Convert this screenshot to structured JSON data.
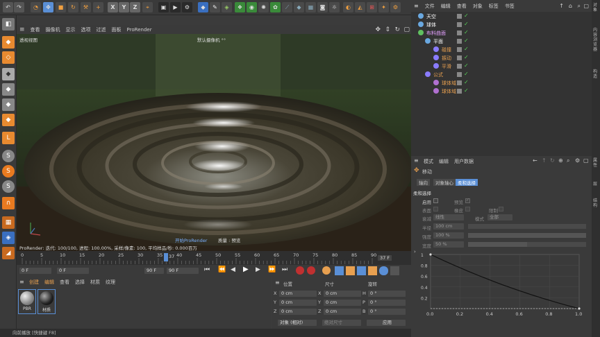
{
  "toolbar": {
    "icons": [
      "undo-icon",
      "redo-icon",
      "live-select-icon",
      "move-icon",
      "scale-icon",
      "rotate-icon",
      "recent-tools-icon",
      "add-icon",
      "x-axis-icon",
      "y-axis-icon",
      "z-axis-icon",
      "coordinate-system-icon",
      "render-region-icon",
      "render-view-icon",
      "render-settings-icon",
      "cube-icon",
      "pen-icon",
      "subdivision-icon",
      "cloner-icon",
      "deformer-icon",
      "environment-icon",
      "camera-icon",
      "light-icon",
      "hair-icon",
      "axis-snap-icon",
      "workplane-icon",
      "script-icon"
    ],
    "axes": [
      "X",
      "Y",
      "Z"
    ]
  },
  "viewport": {
    "menu": [
      "查看",
      "摄像机",
      "显示",
      "选项",
      "过滤",
      "面板",
      "ProRender"
    ],
    "label_left": "透视视图",
    "label_center": "默认摄像机 °°",
    "prorender_button": "开始ProRender",
    "quality": "质量 : 预览",
    "status": "ProRender: 迭代: 100/100, 进程: 100.00%, 采样/像素: 100, 平均样品/秒: 0.000百万"
  },
  "timeline": {
    "ticks": [
      "0",
      "5",
      "10",
      "15",
      "20",
      "25",
      "30",
      "35",
      "40",
      "45",
      "50",
      "55",
      "60",
      "65",
      "70",
      "75",
      "80",
      "85",
      "90"
    ],
    "current_frame": "37",
    "frame_badge": "37 F",
    "start": "0 F",
    "pos": "0 F",
    "end": "90 F",
    "end2": "90 F"
  },
  "material": {
    "menu": [
      "创建",
      "编辑",
      "查看",
      "选择",
      "材质",
      "纹理"
    ],
    "items": [
      {
        "name": "PBR"
      },
      {
        "name": "材质"
      }
    ]
  },
  "coords": {
    "headers": [
      "位置",
      "尺寸",
      "旋转"
    ],
    "rows": [
      {
        "axis": "X",
        "pos": "0 cm",
        "size_axis": "X",
        "size": "0 cm",
        "rot_axis": "H",
        "rot": "0 °"
      },
      {
        "axis": "Y",
        "pos": "0 cm",
        "size_axis": "Y",
        "size": "0 cm",
        "rot_axis": "P",
        "rot": "0 °"
      },
      {
        "axis": "Z",
        "pos": "0 cm",
        "size_axis": "Z",
        "size": "0 cm",
        "rot_axis": "B",
        "rot": "0 °"
      }
    ],
    "mode": "对象 (相对)",
    "size_mode": "绝对尺寸",
    "apply": "应用"
  },
  "status_bar": "向前播放 [快捷键 F8]",
  "object_manager": {
    "menu": [
      "文件",
      "编辑",
      "查看",
      "对象",
      "标签",
      "书签"
    ],
    "objects": [
      {
        "name": "天空",
        "indent": 0,
        "color": "#ffffff",
        "icon": "sky-icon",
        "icon_color": "#6aa8e0"
      },
      {
        "name": "球体",
        "indent": 0,
        "color": "#ffffff",
        "icon": "sphere-icon",
        "icon_color": "#6aa8e0"
      },
      {
        "name": "布料曲面",
        "indent": 0,
        "color": "#e4a0ff",
        "icon": "cloth-surface-icon",
        "icon_color": "#60c060"
      },
      {
        "name": "平面",
        "indent": 1,
        "color": "#ffffff",
        "icon": "plane-icon",
        "icon_color": "#6aa8e0"
      },
      {
        "name": "碰撞",
        "indent": 2,
        "color": "#e8a050",
        "icon": "collision-icon",
        "icon_color": "#8a7cff"
      },
      {
        "name": "振动",
        "indent": 2,
        "color": "#e8a050",
        "icon": "vibrate-icon",
        "icon_color": "#8a7cff"
      },
      {
        "name": "平滑",
        "indent": 2,
        "color": "#e8a050",
        "icon": "smooth-icon",
        "icon_color": "#8a7cff"
      },
      {
        "name": "公式",
        "indent": 1,
        "color": "#e8a050",
        "icon": "formula-icon",
        "icon_color": "#8a7cff"
      },
      {
        "name": "球体域",
        "indent": 2,
        "color": "#e8a050",
        "icon": "sphere-field-icon",
        "icon_color": "#b070d0"
      },
      {
        "name": "球体域",
        "indent": 2,
        "color": "#e8a050",
        "icon": "sphere-field-icon",
        "icon_color": "#b070d0"
      }
    ]
  },
  "attribute_manager": {
    "menu": [
      "模式",
      "编辑",
      "用户数据"
    ],
    "title": "移动",
    "tabs": [
      "轴向",
      "对象轴心",
      "柔和选择"
    ],
    "active_tab": "柔和选择",
    "section": "柔和选择",
    "enable": "启用",
    "preview": "预览",
    "surface": "表面",
    "rubber": "橡皮",
    "limit": "限制",
    "mode_label": "衰减",
    "mode_value": "线性",
    "mode2_label": "模式",
    "mode2_value": "全部",
    "radius_label": "半径",
    "radius_value": "100 cm",
    "strength_label": "强度",
    "strength_value": "100 %",
    "width_label": "宽度",
    "width_value": "50 %"
  },
  "curve": {
    "x_ticks": [
      "0.0",
      "0.2",
      "0.4",
      "0.6",
      "0.8",
      "1.0"
    ],
    "y_ticks": [
      "1",
      "0.8",
      "0.6",
      "0.4",
      "0.2"
    ]
  },
  "right_strip": [
    "对象",
    "内容浏览器",
    "构造",
    "属性",
    "层",
    "结构"
  ],
  "colors": {
    "accent": "#5a8fd6",
    "orange": "#e8a050"
  }
}
